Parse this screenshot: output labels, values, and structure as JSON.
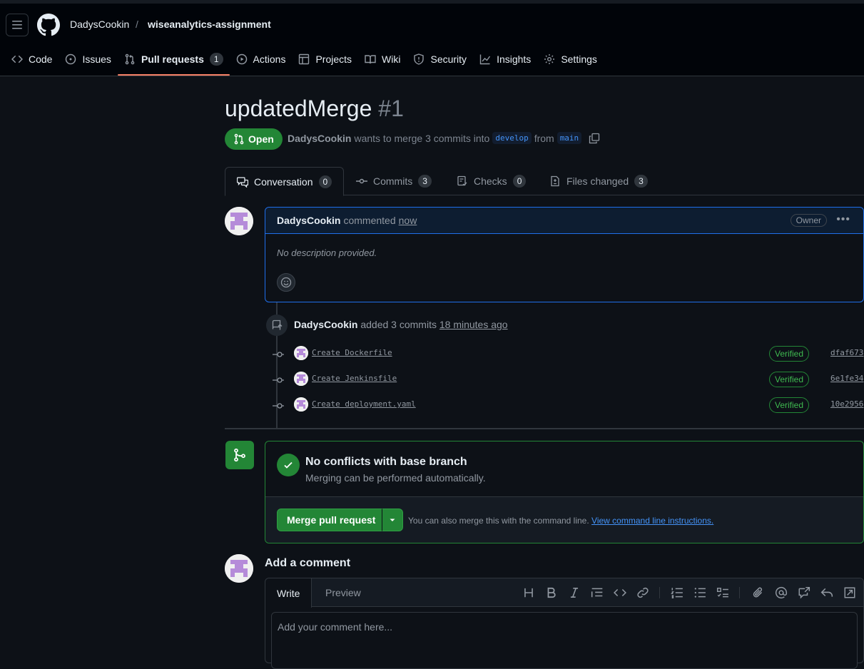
{
  "header": {
    "owner": "DadysCookin",
    "separator": "/",
    "repo": "wiseanalytics-assignment"
  },
  "nav": {
    "items": [
      {
        "label": "Code",
        "icon": "code-icon"
      },
      {
        "label": "Issues",
        "icon": "issue-icon"
      },
      {
        "label": "Pull requests",
        "icon": "pull-request-icon",
        "count": "1",
        "active": true
      },
      {
        "label": "Actions",
        "icon": "play-icon"
      },
      {
        "label": "Projects",
        "icon": "table-icon"
      },
      {
        "label": "Wiki",
        "icon": "book-icon"
      },
      {
        "label": "Security",
        "icon": "shield-icon"
      },
      {
        "label": "Insights",
        "icon": "graph-icon"
      },
      {
        "label": "Settings",
        "icon": "gear-icon"
      }
    ]
  },
  "pr": {
    "title": "updatedMerge",
    "number": "#1",
    "state": "Open",
    "author": "DadysCookin",
    "merge_text": "wants to merge 3 commits into",
    "base_branch": "develop",
    "from_text": "from",
    "head_branch": "main"
  },
  "tabs": [
    {
      "label": "Conversation",
      "count": "0",
      "icon": "comment-discussion-icon"
    },
    {
      "label": "Commits",
      "count": "3",
      "icon": "commit-icon"
    },
    {
      "label": "Checks",
      "count": "0",
      "icon": "checklist-icon"
    },
    {
      "label": "Files changed",
      "count": "3",
      "icon": "file-diff-icon"
    }
  ],
  "comment": {
    "author": "DadysCookin",
    "action": "commented",
    "time": "now",
    "badge": "Owner",
    "body": "No description provided."
  },
  "push": {
    "author": "DadysCookin",
    "action": "added 3 commits",
    "time": "18 minutes ago"
  },
  "commits": [
    {
      "message": "Create Dockerfile",
      "status": "Verified",
      "sha": "dfaf673"
    },
    {
      "message": "Create Jenkinsfile",
      "status": "Verified",
      "sha": "6e1fe34"
    },
    {
      "message": "Create deployment.yaml",
      "status": "Verified",
      "sha": "10e2956"
    }
  ],
  "merge": {
    "title": "No conflicts with base branch",
    "subtitle": "Merging can be performed automatically.",
    "button": "Merge pull request",
    "hint": "You can also merge this with the command line.",
    "hint_link": "View command line instructions."
  },
  "new_comment": {
    "heading": "Add a comment",
    "write_tab": "Write",
    "preview_tab": "Preview",
    "placeholder": "Add your comment here..."
  },
  "colors": {
    "accent_green": "#238636",
    "link_blue": "#4493f8",
    "active_tab_underline": "#f78166"
  }
}
